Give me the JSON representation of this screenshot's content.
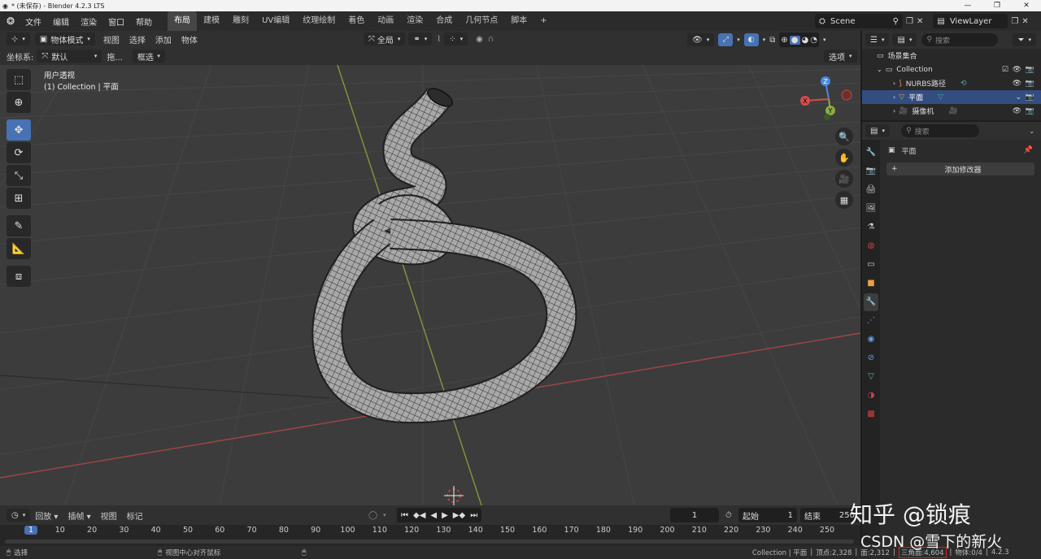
{
  "window": {
    "title": "* (未保存) - Blender 4.2.3 LTS",
    "controls": [
      "—",
      "❐",
      "✕"
    ]
  },
  "menu": {
    "items": [
      "文件",
      "编辑",
      "渲染",
      "窗口",
      "帮助"
    ]
  },
  "workspaces": {
    "tabs": [
      "布局",
      "建模",
      "雕刻",
      "UV编辑",
      "纹理绘制",
      "着色",
      "动画",
      "渲染",
      "合成",
      "几何节点",
      "脚本"
    ],
    "active": "布局",
    "add": "+"
  },
  "scene": {
    "name": "Scene",
    "view_layer": "ViewLayer"
  },
  "viewport_header": {
    "mode": "物体模式",
    "menus": [
      "视图",
      "选择",
      "添加",
      "物体"
    ],
    "transform_orientation": "全局"
  },
  "viewport_header2": {
    "coord_label": "坐标系:",
    "coord_value": "默认",
    "drag_label": "拖...",
    "select_mode": "框选",
    "options": "选项"
  },
  "view_info": {
    "line1": "用户透视",
    "line2": "(1) Collection | 平面"
  },
  "gizmo": {
    "z": "Z",
    "y": "Y",
    "x": "X"
  },
  "timeline": {
    "menus": [
      "回放",
      "插帧",
      "视图",
      "标记"
    ],
    "current_frame": "1",
    "start_label": "起始",
    "start_value": "1",
    "end_label": "结束",
    "end_value": "250",
    "ruler": [
      "1",
      "10",
      "20",
      "30",
      "40",
      "50",
      "60",
      "70",
      "80",
      "90",
      "100",
      "110",
      "120",
      "130",
      "140",
      "150",
      "160",
      "170",
      "180",
      "190",
      "200",
      "210",
      "220",
      "230",
      "240",
      "250"
    ]
  },
  "outliner": {
    "search_placeholder": "搜索",
    "root": "场景集合",
    "collection": "Collection",
    "items": [
      {
        "name": "NURBS路径",
        "selected": false
      },
      {
        "name": "平面",
        "selected": true
      },
      {
        "name": "摄像机",
        "selected": false
      }
    ]
  },
  "properties": {
    "search_placeholder": "搜索",
    "object_name": "平面",
    "add_modifier": "添加修改器"
  },
  "status": {
    "select": "选择",
    "center_view": "视图中心对齐鼠标",
    "collection": "Collection | 平面",
    "vertices": "顶点:2,328",
    "faces": "面:2,312",
    "triangles": "三角面:4,604",
    "objects": "物体:0/4",
    "version": "4.2.3"
  },
  "watermark": {
    "line1": "知乎 @锁痕",
    "line2": "CSDN @雪下的新火"
  },
  "colors": {
    "accent_blue": "#4772b3",
    "selection": "#334d80",
    "axis_red": "#d84c4c",
    "axis_green": "#8aac42",
    "axis_blue": "#4a8ae0",
    "frame_marker": "#4772b3"
  }
}
